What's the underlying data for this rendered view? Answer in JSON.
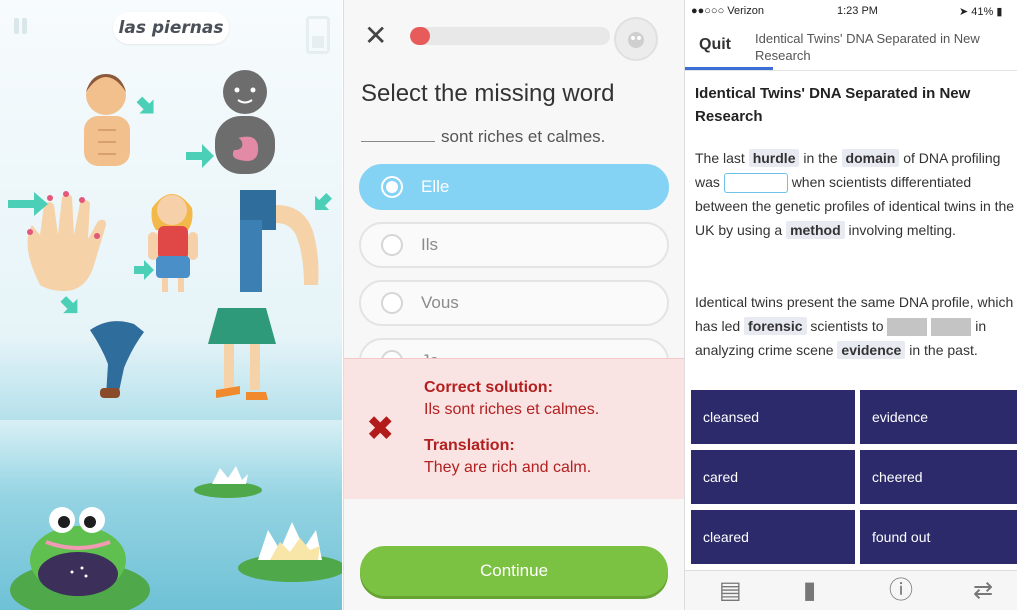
{
  "panel_game": {
    "title": "las piernas",
    "icons": [
      "pause-icon",
      "phone-icon",
      "frog",
      "water-lily"
    ]
  },
  "panel_quiz": {
    "progress_fraction": 0.1,
    "heading": "Select the missing word",
    "sentence_rest": "sont riches et calmes.",
    "options": [
      {
        "label": "Elle",
        "selected": true
      },
      {
        "label": "Ils",
        "selected": false
      },
      {
        "label": "Vous",
        "selected": false
      },
      {
        "label": "Je",
        "selected": false
      }
    ],
    "feedback": {
      "correct_label": "Correct solution:",
      "correct_value": "Ils sont riches et calmes.",
      "translation_label": "Translation:",
      "translation_value": "They are rich and calm."
    },
    "continue_label": "Continue",
    "colors": {
      "selected": "#84d3f5",
      "error": "#b32020",
      "continue": "#7cc242"
    }
  },
  "panel_reader": {
    "status": {
      "carrier": "●●○○○ Verizon",
      "time": "1:23 PM",
      "battery": "41%"
    },
    "quit_label": "Quit",
    "nav_title": "Identical Twins' DNA Separated in New Research",
    "article_title": "Identical Twins' DNA Separated in New Research",
    "para1": {
      "t1": "The last",
      "k1": "hurdle",
      "t2": "in the",
      "k2": "domain",
      "t3": "of DNA profiling was",
      "t4": "when scientists differentiated between the genetic profiles of identical twins in the UK by using a",
      "k3": "method",
      "t5": "involving melting."
    },
    "para2": {
      "t1": "Identical twins present the same DNA profile, which has led",
      "k1": "forensic",
      "t2": "scientists to",
      "t3": "in analyzing crime scene",
      "k2": "evidence",
      "t4": "in the past."
    },
    "choices": [
      "cleansed",
      "evidence",
      "cared",
      "cheered",
      "cleared",
      "found out"
    ],
    "tabs": [
      "document-icon",
      "book-icon",
      "info-icon",
      "swap-icon"
    ]
  }
}
